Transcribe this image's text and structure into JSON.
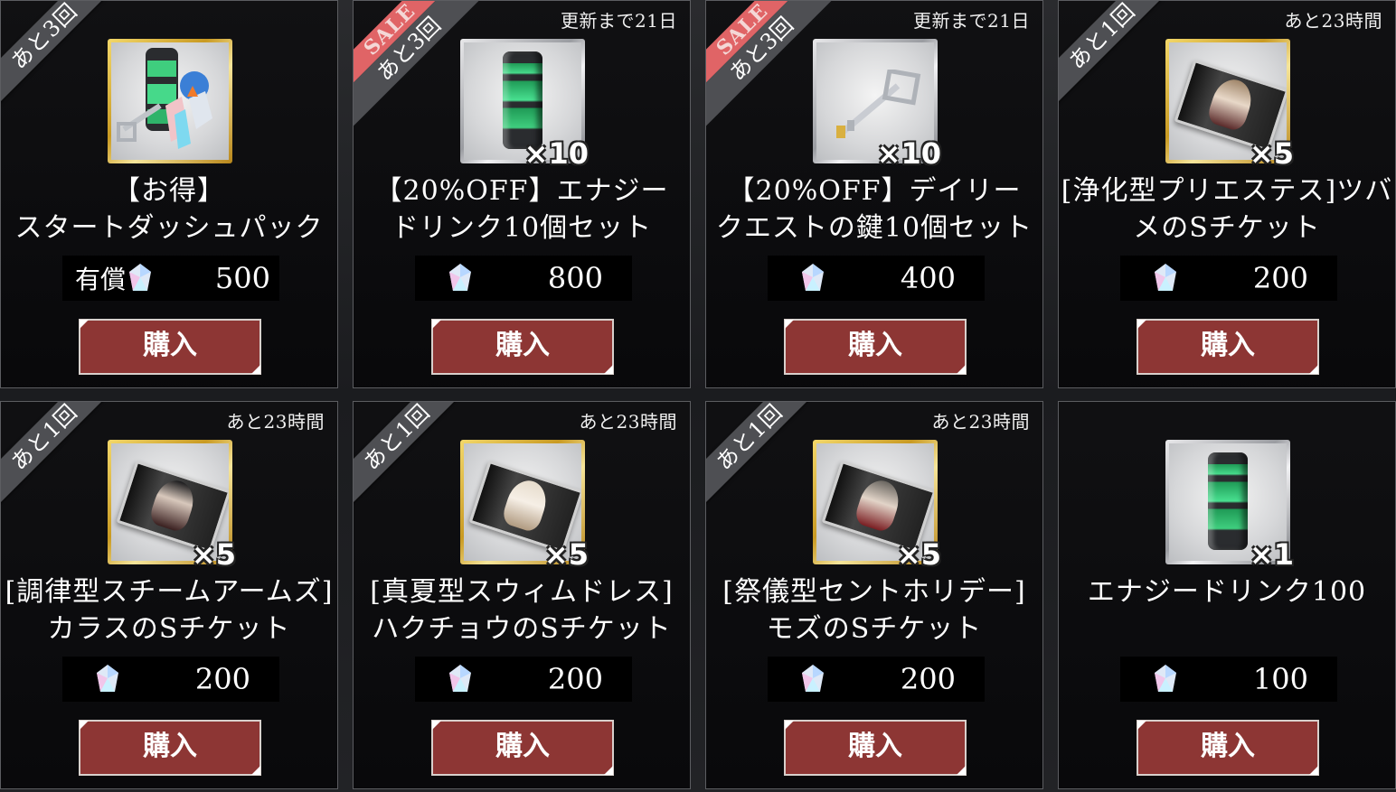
{
  "theme": {
    "button_color": "#8d3634",
    "ribbon_color": "#4e4f53",
    "sale_color": "#e06466"
  },
  "cards": [
    {
      "ribbon": "あと3回",
      "sale_label": "",
      "timer": "",
      "frame": "gold",
      "icon": "start-pack-icon",
      "qty": "",
      "name_line1": "【お得】",
      "name_line2": "スタートダッシュパック",
      "price_label": "有償",
      "price": "500",
      "buy_label": "購入"
    },
    {
      "ribbon": "あと3回",
      "sale_label": "SALE",
      "timer": "更新まで21日",
      "frame": "silver",
      "icon": "energy-drink-icon",
      "qty": "×10",
      "name_line1": "【20%OFF】エナジー",
      "name_line2": "ドリンク10個セット",
      "price_label": "",
      "price": "800",
      "buy_label": "購入"
    },
    {
      "ribbon": "あと3回",
      "sale_label": "SALE",
      "timer": "更新まで21日",
      "frame": "silver",
      "icon": "quest-key-icon",
      "qty": "×10",
      "name_line1": "【20%OFF】デイリー",
      "name_line2": "クエストの鍵10個セット",
      "price_label": "",
      "price": "400",
      "buy_label": "購入"
    },
    {
      "ribbon": "あと1回",
      "sale_label": "",
      "timer": "あと23時間",
      "frame": "gold",
      "icon": "s-ticket-icon",
      "qty": "×5",
      "name_line1": "[浄化型プリエステス]ツバ",
      "name_line2": "メのSチケット",
      "price_label": "",
      "price": "200",
      "buy_label": "購入"
    },
    {
      "ribbon": "あと1回",
      "sale_label": "",
      "timer": "あと23時間",
      "frame": "gold",
      "icon": "s-ticket-icon",
      "qty": "×5",
      "name_line1": "[調律型スチームアームズ]",
      "name_line2": "カラスのSチケット",
      "price_label": "",
      "price": "200",
      "buy_label": "購入"
    },
    {
      "ribbon": "あと1回",
      "sale_label": "",
      "timer": "あと23時間",
      "frame": "gold",
      "icon": "s-ticket-icon",
      "qty": "×5",
      "name_line1": "[真夏型スウィムドレス]",
      "name_line2": "ハクチョウのSチケット",
      "price_label": "",
      "price": "200",
      "buy_label": "購入"
    },
    {
      "ribbon": "あと1回",
      "sale_label": "",
      "timer": "あと23時間",
      "frame": "gold",
      "icon": "s-ticket-icon",
      "qty": "×5",
      "name_line1": "[祭儀型セントホリデー]",
      "name_line2": "モズのSチケット",
      "price_label": "",
      "price": "200",
      "buy_label": "購入"
    },
    {
      "ribbon": "",
      "sale_label": "",
      "timer": "",
      "frame": "silver",
      "icon": "energy-drink-icon",
      "qty": "×1",
      "name_line1": "エナジードリンク100",
      "name_line2": "",
      "price_label": "",
      "price": "100",
      "buy_label": "購入"
    }
  ]
}
